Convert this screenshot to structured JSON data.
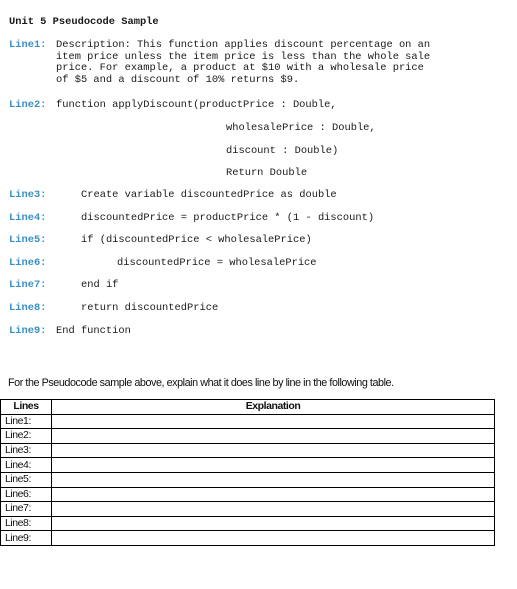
{
  "document": {
    "title": "Unit 5 Pseudocode Sample",
    "pseudocode": {
      "line1": {
        "label": "Line1:",
        "text": "Description: This function applies discount percentage on an\nitem price unless the item price is less than the whole sale\nprice. For example, a product at $10 with a wholesale price\nof $5 and a discount of 10% returns $9."
      },
      "line2": {
        "label": "Line2:",
        "text": "function applyDiscount(productPrice : Double,",
        "continuation": [
          "wholesalePrice : Double,",
          "discount : Double)",
          "Return Double"
        ]
      },
      "line3": {
        "label": "Line3:",
        "text": "Create variable discountedPrice as double"
      },
      "line4": {
        "label": "Line4:",
        "text": "discountedPrice = productPrice * (1 - discount)"
      },
      "line5": {
        "label": "Line5:",
        "text": "if (discountedPrice < wholesalePrice)"
      },
      "line6": {
        "label": "Line6:",
        "text": "discountedPrice = wholesalePrice"
      },
      "line7": {
        "label": "Line7:",
        "text": "end if"
      },
      "line8": {
        "label": "Line8:",
        "text": "return discountedPrice"
      },
      "line9": {
        "label": "Line9:",
        "text": "End function"
      }
    },
    "instruction": "For the Pseudocode sample above, explain what it does line by line in the following table.",
    "table": {
      "headers": [
        "Lines",
        "Explanation"
      ],
      "rows": [
        {
          "line": "Line1:",
          "explanation": ""
        },
        {
          "line": "Line2:",
          "explanation": ""
        },
        {
          "line": "Line3:",
          "explanation": ""
        },
        {
          "line": "Line4:",
          "explanation": ""
        },
        {
          "line": "Line5:",
          "explanation": ""
        },
        {
          "line": "Line6:",
          "explanation": ""
        },
        {
          "line": "Line7:",
          "explanation": ""
        },
        {
          "line": "Line8:",
          "explanation": ""
        },
        {
          "line": "Line9:",
          "explanation": ""
        }
      ]
    }
  },
  "colors": {
    "line_label": "#3a8fc4",
    "text": "#1a1a1a",
    "table_border": "#000000"
  }
}
